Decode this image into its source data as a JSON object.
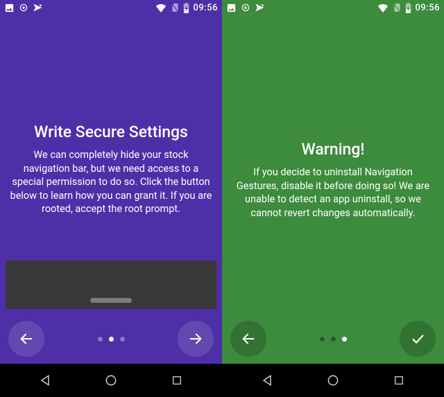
{
  "status": {
    "time": "09:56"
  },
  "left": {
    "bg": "#4e2fa8",
    "title": "Write Secure Settings",
    "body": "We can completely hide your stock navigation bar, but we need access to a special permission to do so. Click the button below to learn how you can grant it. If you are rooted, accept the root prompt.",
    "pager": {
      "count": 3,
      "active": 1
    }
  },
  "right": {
    "bg": "#3d8b3d",
    "title": "Warning!",
    "body": "If you decide to uninstall Navigation Gestures, disable it before doing so! We are unable to detect an app uninstall, so we cannot revert changes automatically.",
    "pager": {
      "count": 3,
      "active": 2
    }
  }
}
